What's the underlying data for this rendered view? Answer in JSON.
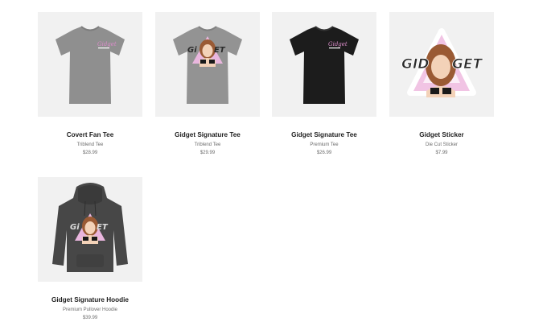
{
  "products": [
    {
      "name": "Covert Fan Tee",
      "type": "Triblend Tee",
      "price": "$28.99",
      "garment_color": "#8f8f8f",
      "icon": "tshirt-icon",
      "print": "chest-logo"
    },
    {
      "name": "Gidget Signature Tee",
      "type": "Triblend Tee",
      "price": "$29.99",
      "garment_color": "#939393",
      "icon": "tshirt-icon",
      "print": "character-logo"
    },
    {
      "name": "Gidget Signature Tee",
      "type": "Premium Tee",
      "price": "$26.99",
      "garment_color": "#1c1c1c",
      "icon": "tshirt-icon",
      "print": "chest-logo"
    },
    {
      "name": "Gidget Sticker",
      "type": "Die Cut Sticker",
      "price": "$7.99",
      "garment_color": "#ffffff",
      "icon": "sticker-icon",
      "print": "sticker-art"
    },
    {
      "name": "Gidget Signature Hoodie",
      "type": "Premium Pullover Hoodie",
      "price": "$39.99",
      "garment_color": "#474747",
      "icon": "hoodie-icon",
      "print": "character-logo"
    }
  ],
  "colors": {
    "accent_pink": "#d98cc8",
    "logo_text": "#2a2a2a",
    "thumb_bg": "#f1f1f1"
  }
}
